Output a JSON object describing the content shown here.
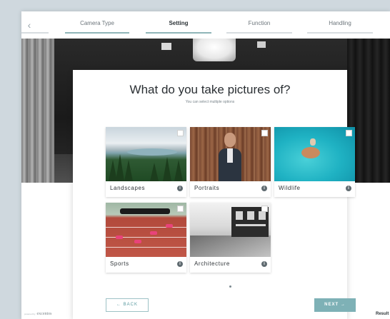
{
  "steps": {
    "back_icon": "chevron-left",
    "items": [
      {
        "label": "Camera Type"
      },
      {
        "label": "Setting"
      },
      {
        "label": "Function"
      },
      {
        "label": "Handling"
      }
    ],
    "active_index": 1
  },
  "card": {
    "title": "What do you take pictures of?",
    "subtitle": "You can select multiple options",
    "options": [
      {
        "label": "Landscapes",
        "info_icon": "i"
      },
      {
        "label": "Portraits",
        "info_icon": "i"
      },
      {
        "label": "Wildlife",
        "info_icon": "i"
      },
      {
        "label": "Sports",
        "info_icon": "i"
      },
      {
        "label": "Architecture",
        "info_icon": "i"
      }
    ],
    "back_label": "← BACK",
    "next_label": "NEXT →"
  },
  "footer": {
    "brand_prefix": "powered by",
    "brand": "excentos",
    "result_label": "Result"
  },
  "colors": {
    "accent": "#7eb1b6",
    "accent_light": "#9ec2c6",
    "text_dark": "#2a2f33"
  }
}
